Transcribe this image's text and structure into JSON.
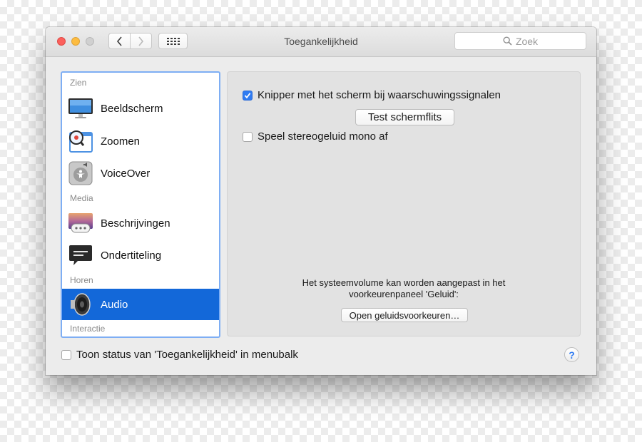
{
  "window": {
    "title": "Toegankelijkheid",
    "search_placeholder": "Zoek"
  },
  "sidebar": {
    "sections": [
      {
        "label": "Zien"
      },
      {
        "label": "Media"
      },
      {
        "label": "Horen"
      },
      {
        "label": "Interactie"
      }
    ],
    "items": [
      {
        "label": "Beeldscherm",
        "icon": "display-icon"
      },
      {
        "label": "Zoomen",
        "icon": "zoom-icon"
      },
      {
        "label": "VoiceOver",
        "icon": "voiceover-icon"
      },
      {
        "label": "Beschrijvingen",
        "icon": "descriptions-icon"
      },
      {
        "label": "Ondertiteling",
        "icon": "captions-icon"
      },
      {
        "label": "Audio",
        "icon": "speaker-icon",
        "selected": true
      }
    ]
  },
  "panel": {
    "flash_checkbox": {
      "label": "Knipper met het scherm bij waarschuwingssignalen",
      "checked": true
    },
    "test_button": "Test schermflits",
    "mono_checkbox": {
      "label": "Speel stereogeluid mono af",
      "checked": false
    },
    "note": "Het systeemvolume kan worden aangepast in het voorkeurenpaneel 'Geluid':",
    "open_button": "Open geluidsvoorkeuren…"
  },
  "footer": {
    "menubar_checkbox": {
      "label": "Toon status van 'Toegankelijkheid' in menubalk",
      "checked": false
    },
    "help_label": "?"
  },
  "colors": {
    "accent": "#2f7bf2",
    "selection": "#1368d9",
    "close": "#fc605c",
    "minimize": "#fdbc40"
  }
}
